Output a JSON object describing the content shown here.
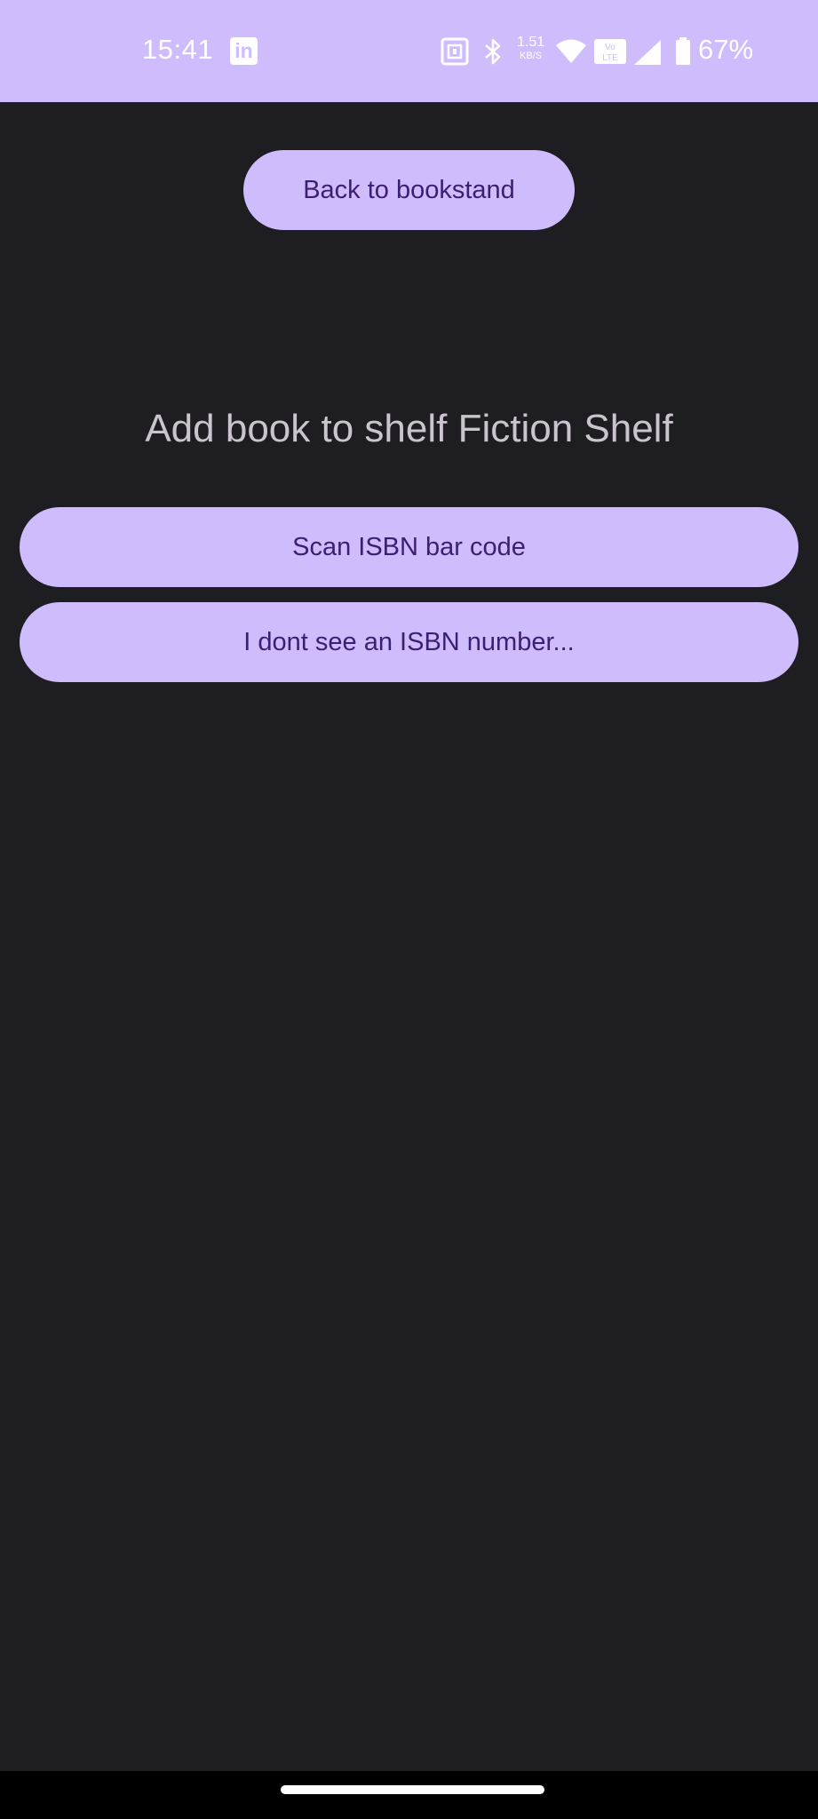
{
  "status_bar": {
    "time": "15:41",
    "speed_value": "1.51",
    "speed_unit": "KB/S",
    "battery_percent": "67%",
    "icons": [
      "linkedin-icon",
      "nfc-icon",
      "bluetooth-icon",
      "wifi-icon",
      "volte-icon",
      "cell-signal-icon",
      "battery-icon"
    ]
  },
  "header": {
    "back_label": "Back to bookstand"
  },
  "main": {
    "title": "Add book to shelf Fiction Shelf",
    "scan_label": "Scan ISBN bar code",
    "no_isbn_label": "I dont see an ISBN number..."
  },
  "colors": {
    "accent": "#cfbcfc",
    "background": "#1e1d21",
    "button_text": "#3b1f73",
    "heading_text": "#cac4cf"
  }
}
